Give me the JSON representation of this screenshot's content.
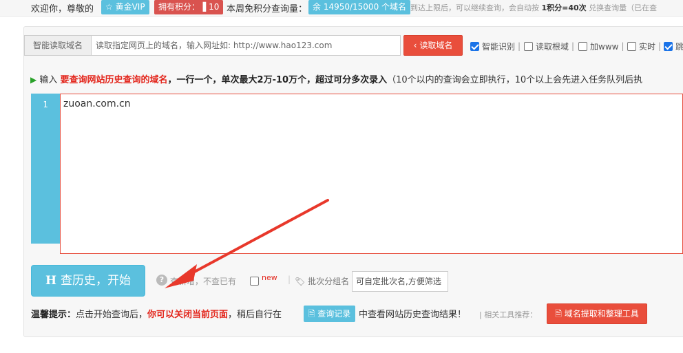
{
  "topbar": {
    "welcome": "欢迎你，尊敬的",
    "vip_badge": "黄金VIP",
    "points_badge": "拥有积分：",
    "points_value": "10",
    "weekly_label": "本周免积分查询量：",
    "quota_badge": "余 14950/15000 个域名",
    "limit_note_pre": "到达上限后，可以继续查询，会自动按",
    "limit_note_rate": "1积分=40次",
    "limit_note_post": "兑换查询量（已在查"
  },
  "read_row": {
    "addon_label": "智能读取域名",
    "url_placeholder": "读取指定网页上的域名，输入网址如: http://www.hao123.com",
    "read_button": "读取域名",
    "options": [
      {
        "label": "智能识别",
        "checked": true
      },
      {
        "label": "读取根域",
        "checked": false
      },
      {
        "label": "加www",
        "checked": false
      },
      {
        "label": "实时",
        "checked": false
      },
      {
        "label": "跳",
        "checked": true
      }
    ]
  },
  "instruction": {
    "prefix": "输入",
    "red": "要查询网站历史查询的域名",
    "mid": "，一行一个，单次最大2万-10万个，超过可分多次录入",
    "note": "（10个以内的查询会立即执行，10个以上会先进入任务队列后执"
  },
  "editor": {
    "line_number": "1",
    "content": "zuoan.com.cn"
  },
  "actions": {
    "start_icon": "H",
    "start_label": "查历史，开始",
    "only_new_label": "查新增，不查已有",
    "new_label": "new",
    "batch_label": "批次分组名",
    "batch_placeholder": "可自定批次名,方便筛选"
  },
  "tip": {
    "title": "温馨提示：",
    "text1": "点击开始查询后，",
    "red": "你可以关闭当前页面",
    "text2": "，稍后自行在",
    "record_button": "查询记录",
    "text3": "中查看网站历史查询结果！",
    "related": "| 相关工具推荐：",
    "tool_button": "域名提取和整理工具"
  },
  "colors": {
    "accent_blue": "#5bc0de",
    "accent_red": "#e94e3c",
    "highlight_red": "#e3261c"
  },
  "icons": [
    "star-icon",
    "signal-icon",
    "chevron-left-icon",
    "help-icon",
    "tag-icon",
    "file-icon",
    "play-icon"
  ]
}
